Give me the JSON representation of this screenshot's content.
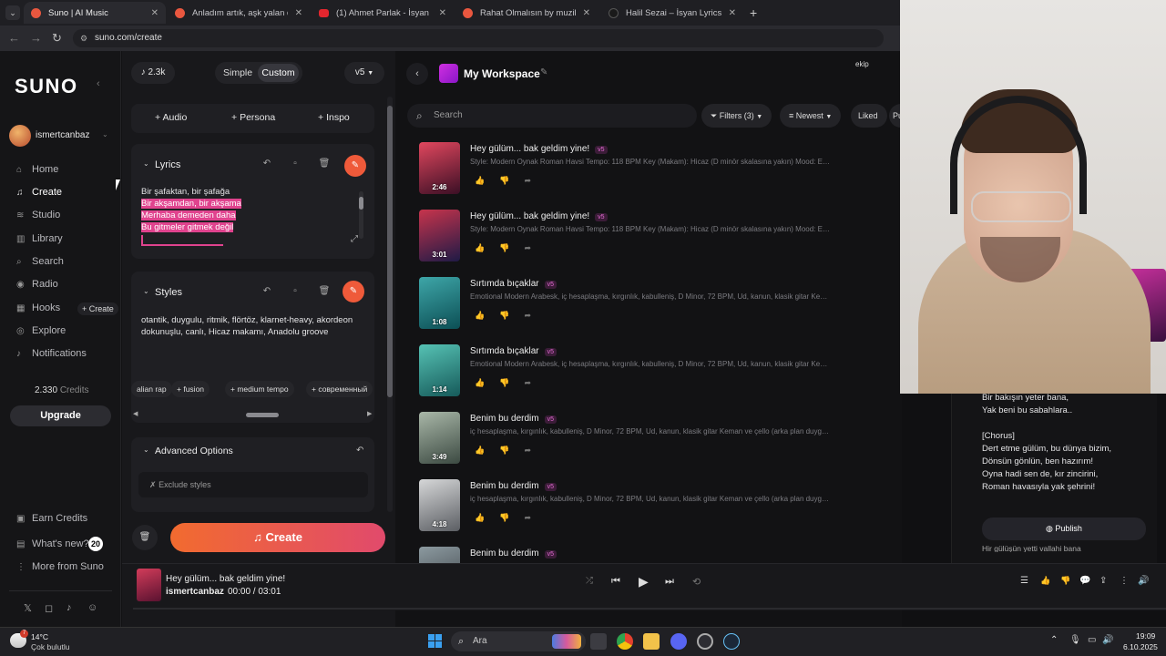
{
  "browser": {
    "tabs": [
      {
        "title": "Suno | AI Music",
        "active": true
      },
      {
        "title": "Anladım artık, aşk yalan dolan l..."
      },
      {
        "title": "(1) Ahmet Parlak - İsyan (Efkan..."
      },
      {
        "title": "Rahat Olmalısın by muzikicin12..."
      },
      {
        "title": "Halil Sezai – İsyan Lyrics | Geniu..."
      }
    ],
    "url": "suno.com/create"
  },
  "sidebar": {
    "logo": "SUNO",
    "user": "ismertcanbaz",
    "items": [
      {
        "label": "Home"
      },
      {
        "label": "Create"
      },
      {
        "label": "Studio"
      },
      {
        "label": "Library"
      },
      {
        "label": "Search"
      },
      {
        "label": "Radio"
      },
      {
        "label": "Hooks"
      },
      {
        "label": "Explore"
      },
      {
        "label": "Notifications"
      }
    ],
    "hooks_badge": "+ Create",
    "credits_value": "2.330",
    "credits_label": "Credits",
    "upgrade": "Upgrade",
    "footer": {
      "earn": "Earn Credits",
      "whats_new": "What's new?",
      "whats_new_count": "20",
      "more": "More from Suno"
    }
  },
  "create": {
    "count": "2.3k",
    "mode_simple": "Simple",
    "mode_custom": "Custom",
    "version": "v5",
    "add_audio": "Audio",
    "add_persona": "Persona",
    "add_inspo": "Inspo",
    "lyrics_title": "Lyrics",
    "lyrics": [
      "Bir şafaktan, bir şafağa",
      "Bir akşamdan, bir akşama",
      "Merhaba demeden daha",
      "Bu gitmeler gitmek değil"
    ],
    "styles_title": "Styles",
    "styles_text_1": "otantik, duygulu, ritmik, flörtöz, klarnet-heavy, akordeon",
    "styles_text_2": "dokunuşlu, canlı, Hicaz makamı, Anadolu groove",
    "tags": [
      "alian rap",
      "fusion",
      "medium tempo",
      "современный"
    ],
    "advanced": "Advanced Options",
    "exclude": "Exclude styles",
    "create_button": "Create"
  },
  "workspace": {
    "title": "My Workspace",
    "search_placeholder": "Search",
    "filters": "Filters (3)",
    "sort": "Newest",
    "liked": "Liked",
    "pu": "Pu",
    "ekip": "ekip",
    "songs": [
      {
        "title": "Hey gülüm... bak geldim yine!",
        "badge": "v5",
        "desc": "Style: Modern Oynak Roman Havsi Tempo: 118 BPM Key (Makam): Hicaz (D minör skalasına yakın) Mood: Eğlenceli, ...",
        "duration": "2:46",
        "color_a": "#e1475e",
        "color_b": "#3b0f25"
      },
      {
        "title": "Hey gülüm... bak geldim yine!",
        "badge": "v5",
        "desc": "Style: Modern Oynak Roman Havsi Tempo: 118 BPM Key (Makam): Hicaz (D minör skalasına yakın) Mood: Eğlenceli, ...",
        "duration": "3:01",
        "color_a": "#c7344c",
        "color_b": "#1f1a46"
      },
      {
        "title": "Sırtımda bıçaklar",
        "badge": "v5",
        "desc": "Emotional Modern Arabesk, iç hesaplaşma, kırgınlık, kabulleniş, D Minor, 72 BPM, Ud, kanun, klasik gitar Keman ve ç...",
        "duration": "1:08",
        "color_a": "#3ea6a8",
        "color_b": "#0c4f55"
      },
      {
        "title": "Sırtımda bıçaklar",
        "badge": "v5",
        "desc": "Emotional Modern Arabesk, iç hesaplaşma, kırgınlık, kabulleniş, D Minor, 72 BPM, Ud, kanun, klasik gitar Keman ve ç...",
        "duration": "1:14",
        "color_a": "#56c2b4",
        "color_b": "#165a5a"
      },
      {
        "title": "Benim bu derdim",
        "badge": "v5",
        "desc": "iç hesaplaşma, kırgınlık, kabulleniş, D Minor, 72 BPM, Ud, kanun, klasik gitar Keman ve çello (arka plan duygusu için)",
        "duration": "3:49",
        "color_a": "#a9b7a8",
        "color_b": "#3c4a42"
      },
      {
        "title": "Benim bu derdim",
        "badge": "v5",
        "desc": "iç hesaplaşma, kırgınlık, kabulleniş, D Minor, 72 BPM, Ud, kanun, klasik gitar Keman ve çello (arka plan duygusu için)",
        "duration": "4:18",
        "color_a": "#d6d7d8",
        "color_b": "#5b5e63"
      },
      {
        "title": "Benim bu derdim",
        "badge": "v5",
        "desc": "",
        "duration": "",
        "color_a": "#8c9aa0",
        "color_b": "#3a3f44"
      }
    ]
  },
  "lyrics_panel": {
    "lines": [
      "Bir bakışın yeter bana,",
      "Yak beni bu sabahlara..",
      "",
      "[Chorus]",
      "Dert etme gülüm, bu dünya bizim,",
      "Dönsün gönlün, ben hazırım!",
      "Oyna hadi sen de, kır zincirini,",
      "Roman havasıyla yak şehrini!"
    ],
    "publish": "Publish",
    "cut_line": "Hir gülüşün yetti vallahi bana"
  },
  "player": {
    "title": "Hey gülüm... bak geldim yine!",
    "artist": "ismertcanbaz",
    "time": "00:00 /  03:01"
  },
  "taskbar": {
    "weather_temp": "14°C",
    "weather_desc": "Çok bulutlu",
    "weather_badge": "7",
    "search": "Ara",
    "time": "19:09",
    "date": "6.10.2025"
  }
}
